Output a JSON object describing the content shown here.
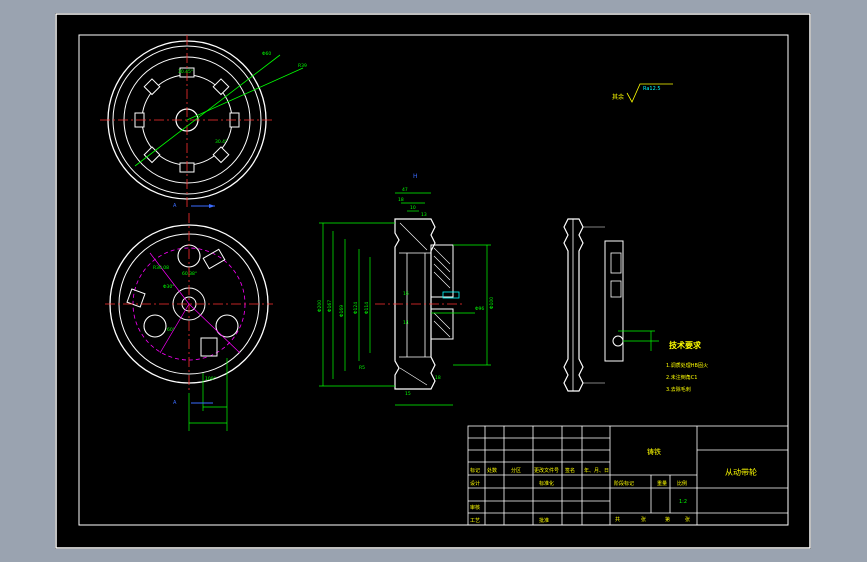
{
  "drawing": {
    "roughness_label": "其余",
    "roughness_value": "Ra12.5",
    "view_marker": "H",
    "section_marker_left": "A",
    "section_marker_lower": "A"
  },
  "dimensions": {
    "top_view": [
      "Φ60",
      "R39",
      "30.45°",
      "30.4°"
    ],
    "bottom_view": [
      "R30.08",
      "60.38°",
      "Φ30°",
      "60°",
      "100°"
    ],
    "section": [
      "47",
      "18",
      "10",
      "13",
      "Φ200",
      "Φ167",
      "Φ169",
      "Φ124",
      "Φ114",
      "Φ96",
      "R5",
      "Φ100",
      "16",
      "14",
      "18",
      "15"
    ],
    "side_view": []
  },
  "technical_requirements": {
    "title": "技术要求",
    "items": [
      "1.调质处理HB固火",
      "2.未注倒角C1",
      "3.去除毛刺"
    ]
  },
  "title_block": {
    "material": "铸铁",
    "part_name": "从动带轮",
    "scale": "1:2",
    "rows": {
      "mark_row": [
        "标记",
        "处数",
        "分区",
        "更改文件号",
        "签名",
        "年、月、日"
      ],
      "design": "设计",
      "standardize": "标准化",
      "stage_mark": "阶段标记",
      "weight": "重量",
      "ratio": "比例",
      "review": "审核",
      "process": "工艺",
      "approve": "批准",
      "sheets": [
        "共",
        "张",
        "第",
        "张"
      ]
    }
  },
  "colors": {
    "white": "#ffffff",
    "green": "#00ff00",
    "red": "#ff3030",
    "magenta": "#ff00ff",
    "yellow": "#ffff00",
    "cyan": "#00ffff",
    "blue": "#3a6bff"
  }
}
